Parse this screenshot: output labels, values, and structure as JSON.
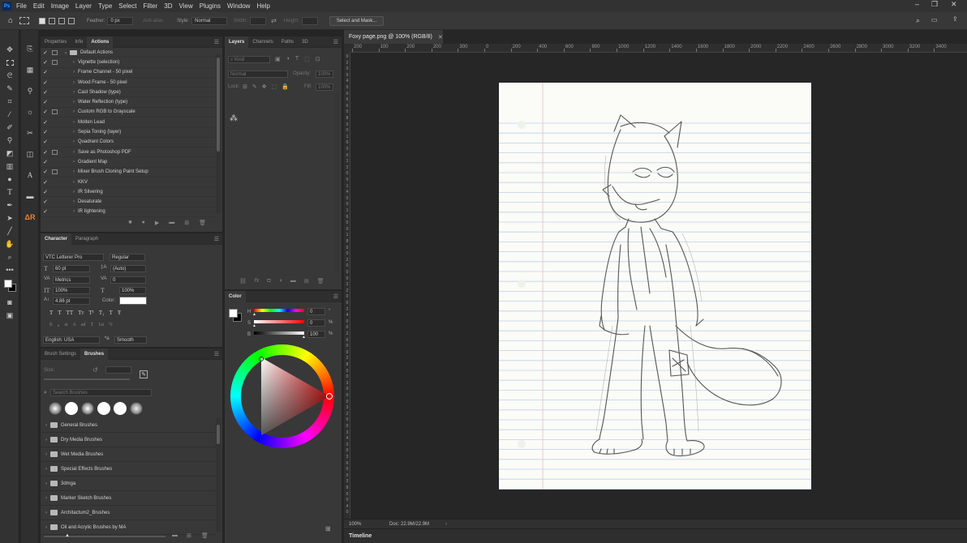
{
  "menubar": {
    "app_logo": "Ps",
    "items": [
      "File",
      "Edit",
      "Image",
      "Layer",
      "Type",
      "Select",
      "Filter",
      "3D",
      "View",
      "Plugins",
      "Window",
      "Help"
    ],
    "window_controls": [
      "minimize-icon",
      "restore-icon",
      "close-icon"
    ]
  },
  "options_bar": {
    "feather_label": "Feather:",
    "feather_value": "0 px",
    "antialias_label": "Anti-alias",
    "style_label": "Style:",
    "style_value": "Normal",
    "width_label": "Width:",
    "height_label": "Height:",
    "select_mask_button": "Select and Mask..."
  },
  "actions_panel": {
    "tabs": [
      "Properties",
      "Info",
      "Actions"
    ],
    "active_tab": "Actions",
    "set_name": "Default Actions",
    "items": [
      {
        "label": "Vignette (selection)",
        "dialog": true
      },
      {
        "label": "Frame Channel - 50 pixel",
        "dialog": false
      },
      {
        "label": "Wood Frame - 50 pixel",
        "dialog": false
      },
      {
        "label": "Cast Shadow (type)",
        "dialog": false
      },
      {
        "label": "Water Reflection (type)",
        "dialog": false
      },
      {
        "label": "Custom RGB to Grayscale",
        "dialog": true
      },
      {
        "label": "Molten Lead",
        "dialog": false
      },
      {
        "label": "Sepia Toning (layer)",
        "dialog": false
      },
      {
        "label": "Quadrant Colors",
        "dialog": false
      },
      {
        "label": "Save as Photoshop PDF",
        "dialog": true
      },
      {
        "label": "Gradient Map",
        "dialog": false
      },
      {
        "label": "Mixer Brush Cloning Paint Setup",
        "dialog": true
      },
      {
        "label": "KKV",
        "dialog": false
      },
      {
        "label": "IR Silvering",
        "dialog": false
      },
      {
        "label": "Desaturate",
        "dialog": false
      },
      {
        "label": "IR Iightening",
        "dialog": false
      }
    ]
  },
  "character_panel": {
    "tabs": [
      "Character",
      "Paragraph"
    ],
    "font_family": "VTC Letterer Pro",
    "font_style": "Regular",
    "font_size": "60 pt",
    "leading": "(Auto)",
    "kerning": "Metrics",
    "tracking": "0",
    "vertical_scale": "100%",
    "horizontal_scale": "100%",
    "baseline_shift": "4.86 pt",
    "color_label": "Color:",
    "language": "English: USA",
    "antialias": "Smooth",
    "style_glyphs": [
      "T",
      "T",
      "TT",
      "Tт",
      "T¹",
      "T₁",
      "T",
      "Ŧ"
    ],
    "opentype_glyphs": [
      "fi",
      "ℴ",
      "st",
      "A",
      "ad",
      "T",
      "1st",
      "½"
    ]
  },
  "brushes_panel": {
    "tabs": [
      "Brush Settings",
      "Brushes"
    ],
    "size_label": "Size:",
    "search_placeholder": "Search Brushes",
    "groups": [
      "General Brushes",
      "Dry Media Brushes",
      "Wet Media Brushes",
      "Special Effects Brushes",
      "3dmga",
      "Marker Sketch Brushes",
      "Architactum2_Brushes",
      "Oil and Acrylic Brushes by MA"
    ]
  },
  "layers_panel": {
    "tabs": [
      "Layers",
      "Channels",
      "Paths",
      "3D"
    ],
    "filter_label": "Kind",
    "blend_mode": "Normal",
    "opacity_label": "Opacity:",
    "opacity_value": "100%",
    "lock_label": "Lock:",
    "fill_label": "Fill:",
    "fill_value": "100%",
    "footer_icons": [
      "link-icon",
      "fx-icon",
      "mask-icon",
      "adjustment-icon",
      "group-icon",
      "new-layer-icon",
      "trash-icon"
    ]
  },
  "color_panel": {
    "title": "Color",
    "h_label": "H",
    "h_value": "0",
    "h_unit": "°",
    "s_label": "S",
    "s_value": "0",
    "s_unit": "%",
    "b_label": "B",
    "b_value": "100",
    "b_unit": "%"
  },
  "document": {
    "tab_title": "Foxy page.png @ 100% (RGB/8)",
    "zoom": "100%",
    "doc_size": "Doc: 22.9M/22.9M",
    "ruler_h": [
      "200",
      "100",
      "200",
      "200",
      "300",
      "0",
      "200",
      "400",
      "600",
      "800",
      "1000",
      "1200",
      "1400",
      "1600",
      "1800",
      "2000",
      "2200",
      "2400",
      "2600",
      "2800",
      "3000",
      "3200",
      "3400"
    ],
    "ruler_v": [
      "0",
      "2",
      "0",
      "0",
      "4",
      "0",
      "0",
      "6",
      "0",
      "0",
      "8",
      "0",
      "0",
      "1",
      "0",
      "0",
      "0",
      "1",
      "2",
      "0",
      "0",
      "1",
      "4",
      "0",
      "0",
      "1",
      "6",
      "0",
      "0",
      "1",
      "8",
      "0",
      "0",
      "2",
      "0",
      "0",
      "0",
      "2",
      "2",
      "0",
      "0",
      "2",
      "4",
      "0",
      "0",
      "2",
      "6",
      "0",
      "0",
      "2",
      "8",
      "0",
      "0",
      "3",
      "0",
      "0",
      "0",
      "3",
      "2",
      "0",
      "0",
      "3",
      "4",
      "0",
      "0",
      "3",
      "6",
      "0",
      "0",
      "3",
      "8",
      "0",
      "0",
      "4",
      "0"
    ]
  },
  "timeline": {
    "label": "Timeline"
  },
  "colors": {
    "ui_bg": "#383838",
    "canvas_bg": "#262626",
    "paper": "#fbfbf7",
    "ruled_line": "#b8d0e6",
    "margin_line": "#d9c2c2"
  }
}
